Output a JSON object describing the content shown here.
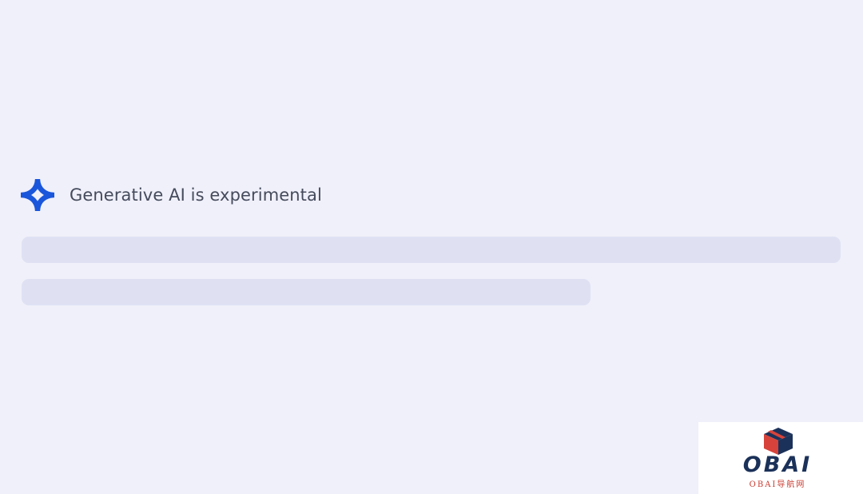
{
  "header": {
    "icon": "sparkle-icon",
    "title": "Generative AI is experimental"
  },
  "loading_state": {
    "placeholder_lines": 2
  },
  "watermark": {
    "wordmark": "OBAI",
    "caption": "OBAI导航网"
  },
  "colors": {
    "background": "#f0f0fa",
    "accent": "#1a56db",
    "skeleton": "#dfe1f3",
    "title_text": "#454b5c",
    "watermark_navy": "#1b3159",
    "watermark_red": "#c9392e"
  }
}
